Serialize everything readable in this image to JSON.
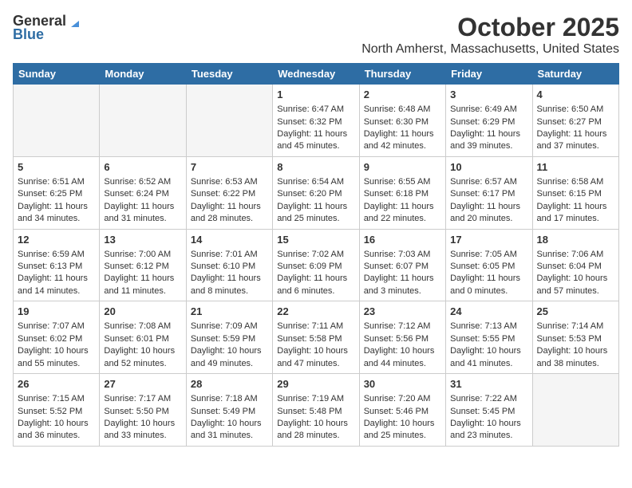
{
  "logo": {
    "general": "General",
    "blue": "Blue"
  },
  "header": {
    "month": "October 2025",
    "location": "North Amherst, Massachusetts, United States"
  },
  "weekdays": [
    "Sunday",
    "Monday",
    "Tuesday",
    "Wednesday",
    "Thursday",
    "Friday",
    "Saturday"
  ],
  "weeks": [
    [
      {
        "day": "",
        "empty": true
      },
      {
        "day": "",
        "empty": true
      },
      {
        "day": "",
        "empty": true
      },
      {
        "day": "1",
        "sunrise": "6:47 AM",
        "sunset": "6:32 PM",
        "daylight": "11 hours and 45 minutes."
      },
      {
        "day": "2",
        "sunrise": "6:48 AM",
        "sunset": "6:30 PM",
        "daylight": "11 hours and 42 minutes."
      },
      {
        "day": "3",
        "sunrise": "6:49 AM",
        "sunset": "6:29 PM",
        "daylight": "11 hours and 39 minutes."
      },
      {
        "day": "4",
        "sunrise": "6:50 AM",
        "sunset": "6:27 PM",
        "daylight": "11 hours and 37 minutes."
      }
    ],
    [
      {
        "day": "5",
        "sunrise": "6:51 AM",
        "sunset": "6:25 PM",
        "daylight": "11 hours and 34 minutes."
      },
      {
        "day": "6",
        "sunrise": "6:52 AM",
        "sunset": "6:24 PM",
        "daylight": "11 hours and 31 minutes."
      },
      {
        "day": "7",
        "sunrise": "6:53 AM",
        "sunset": "6:22 PM",
        "daylight": "11 hours and 28 minutes."
      },
      {
        "day": "8",
        "sunrise": "6:54 AM",
        "sunset": "6:20 PM",
        "daylight": "11 hours and 25 minutes."
      },
      {
        "day": "9",
        "sunrise": "6:55 AM",
        "sunset": "6:18 PM",
        "daylight": "11 hours and 22 minutes."
      },
      {
        "day": "10",
        "sunrise": "6:57 AM",
        "sunset": "6:17 PM",
        "daylight": "11 hours and 20 minutes."
      },
      {
        "day": "11",
        "sunrise": "6:58 AM",
        "sunset": "6:15 PM",
        "daylight": "11 hours and 17 minutes."
      }
    ],
    [
      {
        "day": "12",
        "sunrise": "6:59 AM",
        "sunset": "6:13 PM",
        "daylight": "11 hours and 14 minutes."
      },
      {
        "day": "13",
        "sunrise": "7:00 AM",
        "sunset": "6:12 PM",
        "daylight": "11 hours and 11 minutes."
      },
      {
        "day": "14",
        "sunrise": "7:01 AM",
        "sunset": "6:10 PM",
        "daylight": "11 hours and 8 minutes."
      },
      {
        "day": "15",
        "sunrise": "7:02 AM",
        "sunset": "6:09 PM",
        "daylight": "11 hours and 6 minutes."
      },
      {
        "day": "16",
        "sunrise": "7:03 AM",
        "sunset": "6:07 PM",
        "daylight": "11 hours and 3 minutes."
      },
      {
        "day": "17",
        "sunrise": "7:05 AM",
        "sunset": "6:05 PM",
        "daylight": "11 hours and 0 minutes."
      },
      {
        "day": "18",
        "sunrise": "7:06 AM",
        "sunset": "6:04 PM",
        "daylight": "10 hours and 57 minutes."
      }
    ],
    [
      {
        "day": "19",
        "sunrise": "7:07 AM",
        "sunset": "6:02 PM",
        "daylight": "10 hours and 55 minutes."
      },
      {
        "day": "20",
        "sunrise": "7:08 AM",
        "sunset": "6:01 PM",
        "daylight": "10 hours and 52 minutes."
      },
      {
        "day": "21",
        "sunrise": "7:09 AM",
        "sunset": "5:59 PM",
        "daylight": "10 hours and 49 minutes."
      },
      {
        "day": "22",
        "sunrise": "7:11 AM",
        "sunset": "5:58 PM",
        "daylight": "10 hours and 47 minutes."
      },
      {
        "day": "23",
        "sunrise": "7:12 AM",
        "sunset": "5:56 PM",
        "daylight": "10 hours and 44 minutes."
      },
      {
        "day": "24",
        "sunrise": "7:13 AM",
        "sunset": "5:55 PM",
        "daylight": "10 hours and 41 minutes."
      },
      {
        "day": "25",
        "sunrise": "7:14 AM",
        "sunset": "5:53 PM",
        "daylight": "10 hours and 38 minutes."
      }
    ],
    [
      {
        "day": "26",
        "sunrise": "7:15 AM",
        "sunset": "5:52 PM",
        "daylight": "10 hours and 36 minutes."
      },
      {
        "day": "27",
        "sunrise": "7:17 AM",
        "sunset": "5:50 PM",
        "daylight": "10 hours and 33 minutes."
      },
      {
        "day": "28",
        "sunrise": "7:18 AM",
        "sunset": "5:49 PM",
        "daylight": "10 hours and 31 minutes."
      },
      {
        "day": "29",
        "sunrise": "7:19 AM",
        "sunset": "5:48 PM",
        "daylight": "10 hours and 28 minutes."
      },
      {
        "day": "30",
        "sunrise": "7:20 AM",
        "sunset": "5:46 PM",
        "daylight": "10 hours and 25 minutes."
      },
      {
        "day": "31",
        "sunrise": "7:22 AM",
        "sunset": "5:45 PM",
        "daylight": "10 hours and 23 minutes."
      },
      {
        "day": "",
        "empty": true
      }
    ]
  ],
  "labels": {
    "sunrise": "Sunrise:",
    "sunset": "Sunset:",
    "daylight": "Daylight:"
  }
}
